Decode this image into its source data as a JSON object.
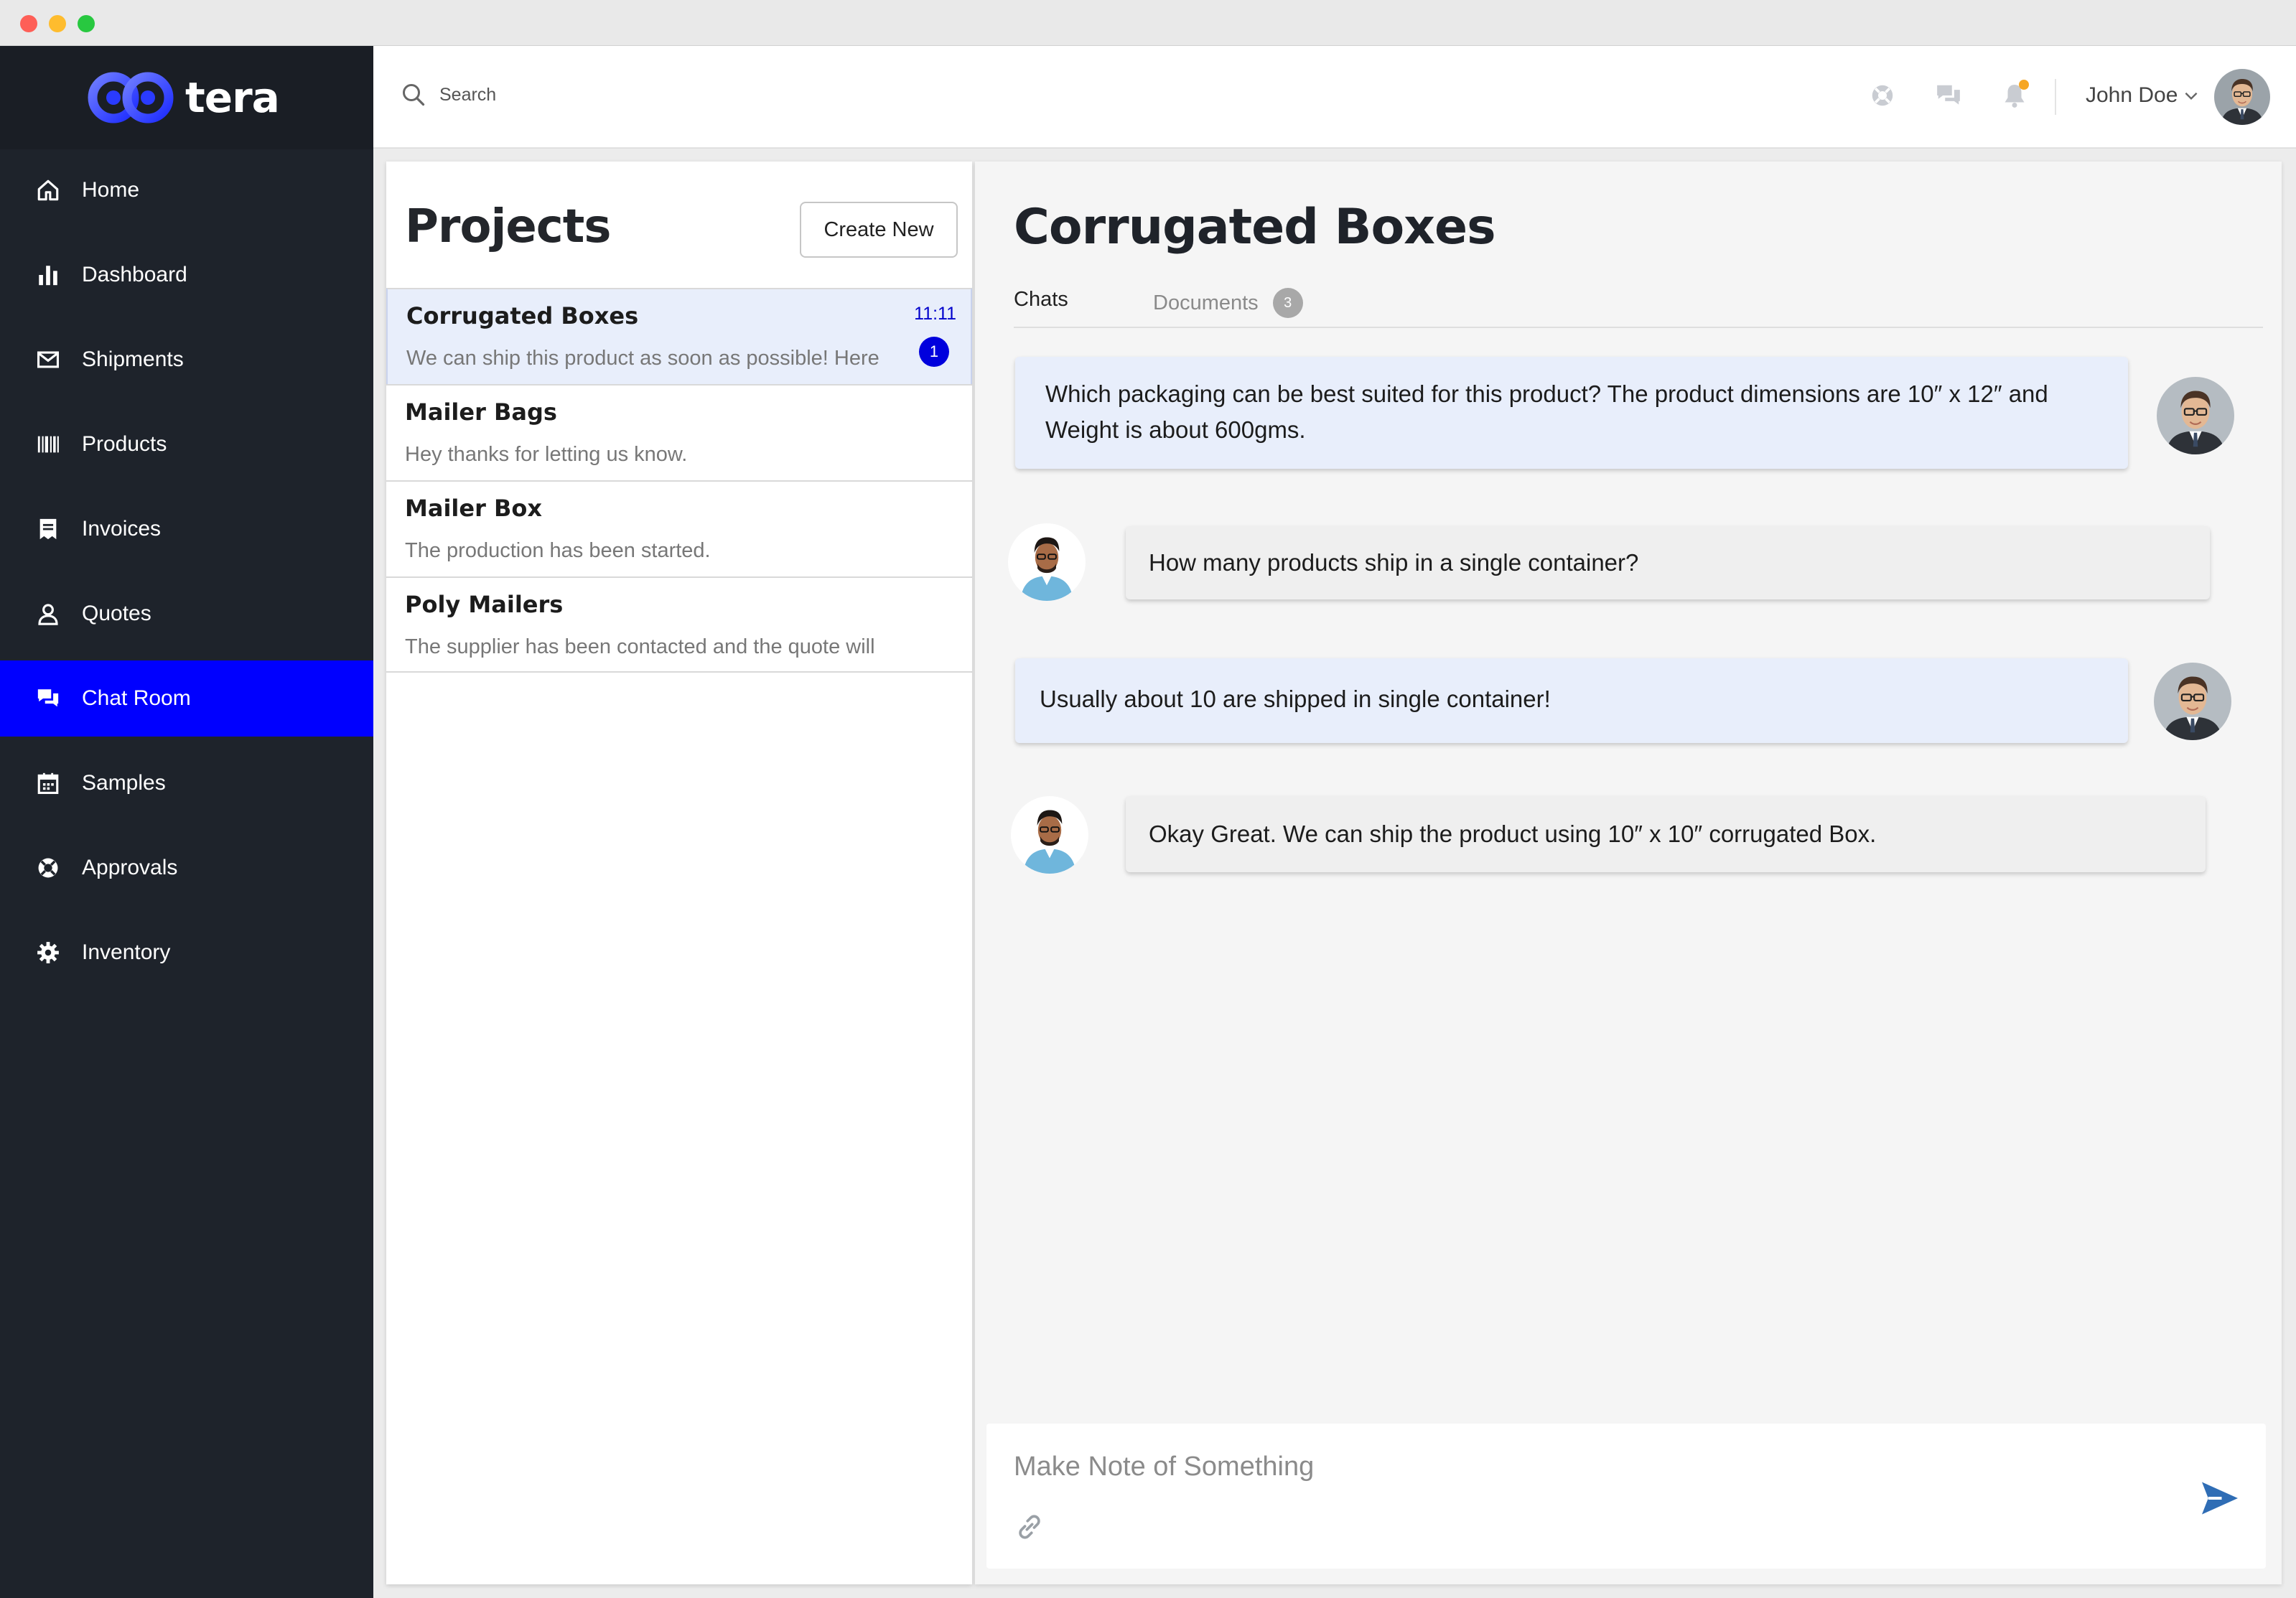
{
  "app": {
    "brand": "tera"
  },
  "sidebar": {
    "items": [
      {
        "label": "Home",
        "icon": "home-icon"
      },
      {
        "label": "Dashboard",
        "icon": "bar-chart-icon"
      },
      {
        "label": "Shipments",
        "icon": "envelope-icon"
      },
      {
        "label": "Products",
        "icon": "barcode-icon"
      },
      {
        "label": "Invoices",
        "icon": "invoice-icon"
      },
      {
        "label": "Quotes",
        "icon": "user-icon"
      },
      {
        "label": "Chat Room",
        "icon": "chat-icon",
        "active": true
      },
      {
        "label": "Samples",
        "icon": "calendar-icon"
      },
      {
        "label": "Approvals",
        "icon": "lifebuoy-icon"
      },
      {
        "label": "Inventory",
        "icon": "gear-icon"
      }
    ]
  },
  "header": {
    "search_placeholder": "Search",
    "user_name": "John Doe"
  },
  "projects": {
    "title": "Projects",
    "create_label": "Create New",
    "items": [
      {
        "name": "Corrugated Boxes",
        "preview": "We can ship this product as soon as possible! Here",
        "time": "11:11",
        "unread": "1",
        "active": true
      },
      {
        "name": "Mailer Bags",
        "preview": "Hey thanks for letting us know."
      },
      {
        "name": "Mailer Box",
        "preview": "The production has been started."
      },
      {
        "name": "Poly Mailers",
        "preview": "The supplier has been contacted and the quote will"
      }
    ]
  },
  "chat": {
    "title": "Corrugated Boxes",
    "tabs": {
      "chats": "Chats",
      "documents": "Documents",
      "documents_count": "3"
    },
    "messages": [
      {
        "side": "out",
        "text": "Which packaging can be best suited for this product? The product dimensions are 10″ x 12″ and Weight is about 600gms."
      },
      {
        "side": "in",
        "text": "How many products ship in a single container?"
      },
      {
        "side": "out",
        "text": "Usually about 10 are shipped in single container!"
      },
      {
        "side": "in",
        "text": "Okay Great. We can ship the product using 10″ x 10″ corrugated Box."
      }
    ],
    "composer_placeholder": "Make Note of Something"
  },
  "colors": {
    "sidebar_bg": "#1e232b",
    "active_nav": "#0000ff",
    "outgoing_bubble": "#e8eefb",
    "incoming_bubble": "#efefef",
    "send_icon": "#2f6db5",
    "notification_dot": "#f6a623"
  }
}
